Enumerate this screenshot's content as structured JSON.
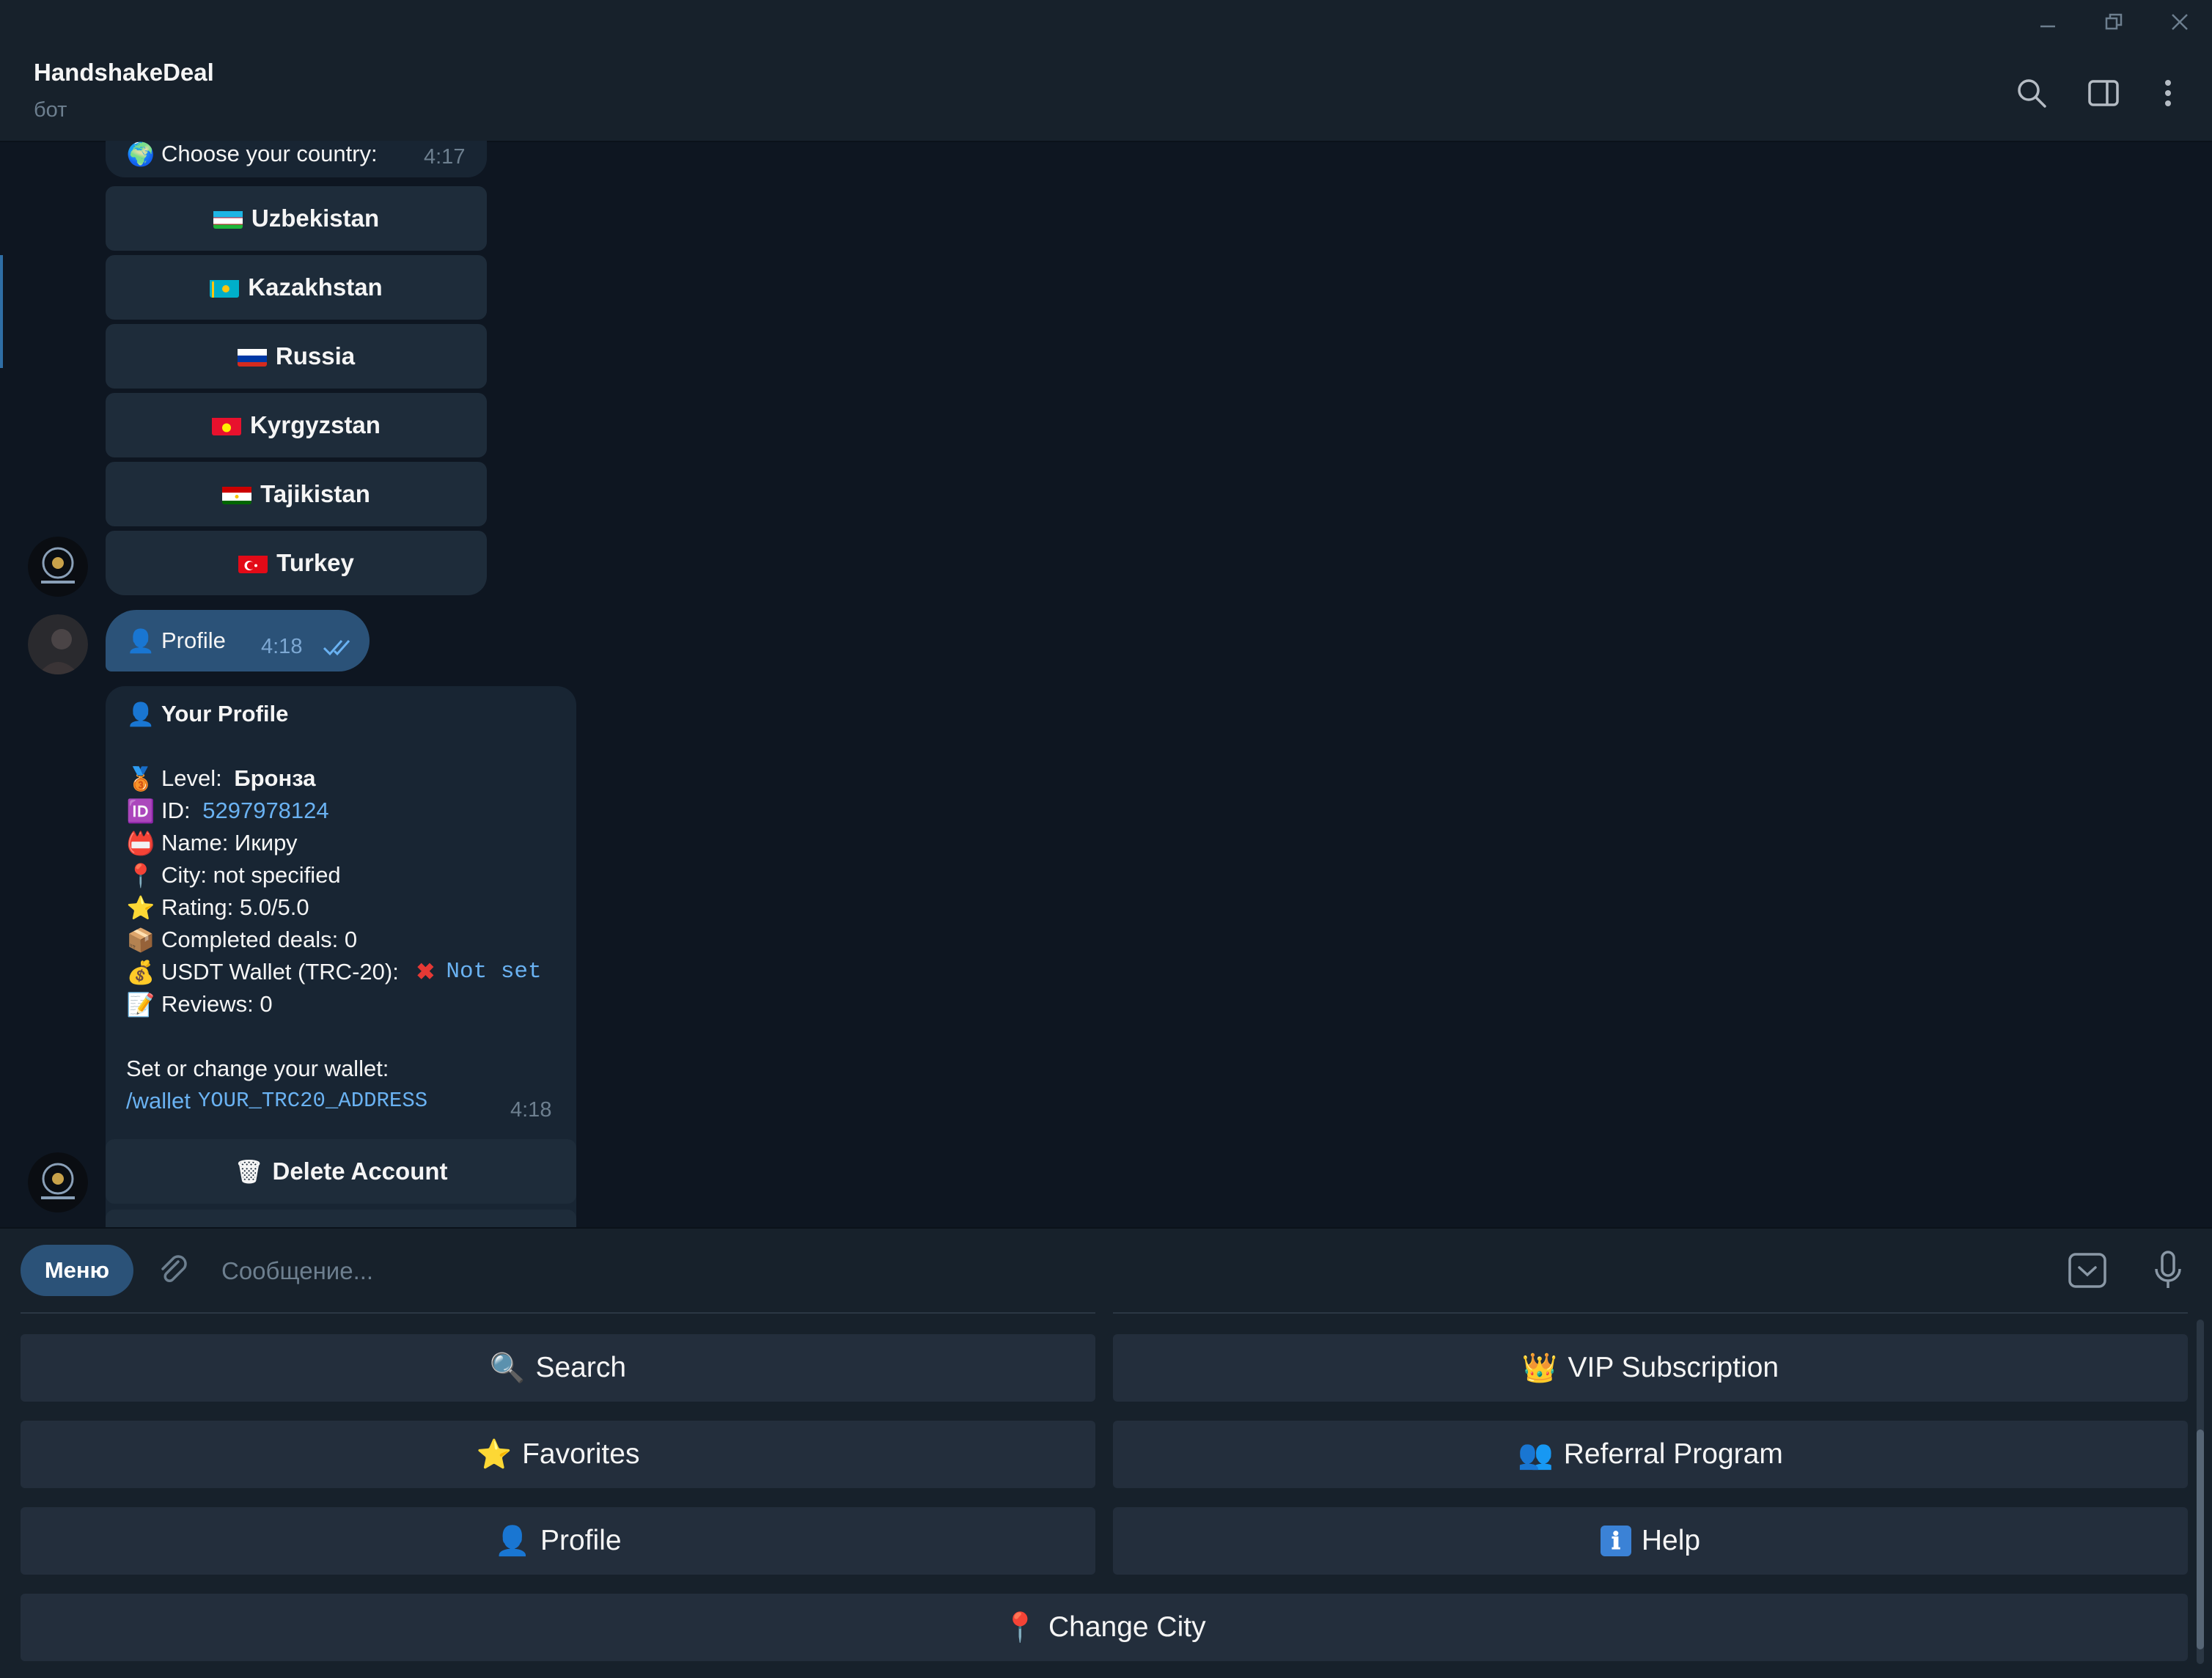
{
  "window": {
    "controls": [
      "minimize",
      "restore",
      "close"
    ]
  },
  "header": {
    "title": "HandshakeDeal",
    "subtitle": "бот",
    "icons": [
      "search-icon",
      "sidebar-toggle-icon",
      "more-icon"
    ]
  },
  "messages": {
    "country_prompt": {
      "emoji": "🌍",
      "text": "Choose your country:",
      "time": "4:17"
    },
    "countries": [
      {
        "label": "Uzbekistan"
      },
      {
        "label": "Kazakhstan"
      },
      {
        "label": "Russia"
      },
      {
        "label": "Kyrgyzstan"
      },
      {
        "label": "Tajikistan"
      },
      {
        "label": "Turkey"
      }
    ],
    "outgoing": {
      "emoji": "👤",
      "text": "Profile",
      "time": "4:18"
    },
    "profile": {
      "title_emoji": "👤",
      "title": "Your Profile",
      "level_label": "Level: ",
      "level_value": "Бронза",
      "id_label": "ID: ",
      "id_value": "5297978124",
      "name": "Name: Икиру",
      "city": "City: not specified",
      "rating": "Rating: 5.0/5.0",
      "deals": "Completed deals: 0",
      "wallet_label": "USDT Wallet (TRC-20): ",
      "wallet_value": "Not set",
      "reviews": "Reviews: 0",
      "instruction": "Set or change your wallet:",
      "command": "/wallet",
      "command_arg": "YOUR_TRC20_ADDRESS",
      "time": "4:18"
    },
    "delete_button": {
      "emoji": "🗑",
      "label": "Delete Account"
    }
  },
  "composer": {
    "menu_label": "Меню",
    "placeholder": "Сообщение...",
    "value": ""
  },
  "reply_keyboard": {
    "search": {
      "emoji": "🔍",
      "label": "Search"
    },
    "vip": {
      "emoji": "👑",
      "label": "VIP Subscription"
    },
    "favorites": {
      "emoji": "⭐",
      "label": "Favorites"
    },
    "referral": {
      "emoji": "👥",
      "label": "Referral Program"
    },
    "profile": {
      "emoji": "👤",
      "label": "Profile"
    },
    "help": {
      "emoji": "ℹ",
      "label": "Help"
    },
    "change_city": {
      "emoji": "📍",
      "label": "Change City"
    }
  },
  "colors": {
    "background": "#0e1621",
    "panel": "#17212b",
    "incoming_bubble": "#182533",
    "outgoing_bubble": "#2b5278",
    "link": "#6ab2f2",
    "muted": "#6d7f8f"
  }
}
